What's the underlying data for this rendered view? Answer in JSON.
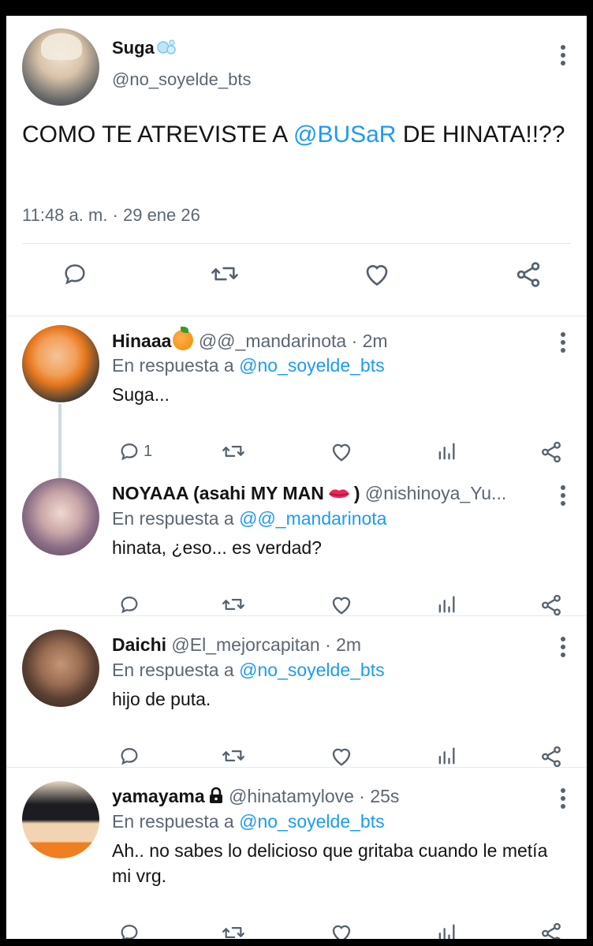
{
  "main_tweet": {
    "author_name": "Suga",
    "author_handle": "@no_soyelde_bts",
    "text_before": "COMO TE ATREVISTE A ",
    "mention": "@BUSaR",
    "text_after": " DE HINATA!!??",
    "timestamp": "11:48 a. m. · 29 ene 26"
  },
  "replies": [
    {
      "name": "Hinaaa",
      "handle": "@@_mandarinota · 2m",
      "in_reply_prefix": "En respuesta a ",
      "in_reply_to": "@no_soyelde_bts",
      "body": "Suga...",
      "reply_count": "1"
    },
    {
      "name": "NOYAAA (asahi MY MAN",
      "name_suffix": ")",
      "handle": "@nishinoya_Yu...",
      "in_reply_prefix": "En respuesta a ",
      "in_reply_to": "@@_mandarinota",
      "body": "hinata, ¿eso... es verdad?"
    },
    {
      "name": "Daichi",
      "handle": "@El_mejorcapitan · 2m",
      "in_reply_prefix": "En respuesta a ",
      "in_reply_to": "@no_soyelde_bts",
      "body": "hijo de puta."
    },
    {
      "name": "yamayama",
      "handle": "@hinatamylove · 25s",
      "in_reply_prefix": "En respuesta a ",
      "in_reply_to": "@no_soyelde_bts",
      "body": "Ah.. no sabes lo delicioso que gritaba cuando le metía mi vrg."
    }
  ],
  "colors": {
    "link": "#1d9bf0",
    "secondary_text": "#5b6772",
    "icon": "#55626d"
  },
  "icons": [
    "more-vert-icon",
    "reply-icon",
    "retweet-icon",
    "like-icon",
    "analytics-icon",
    "share-icon",
    "lock-icon"
  ]
}
